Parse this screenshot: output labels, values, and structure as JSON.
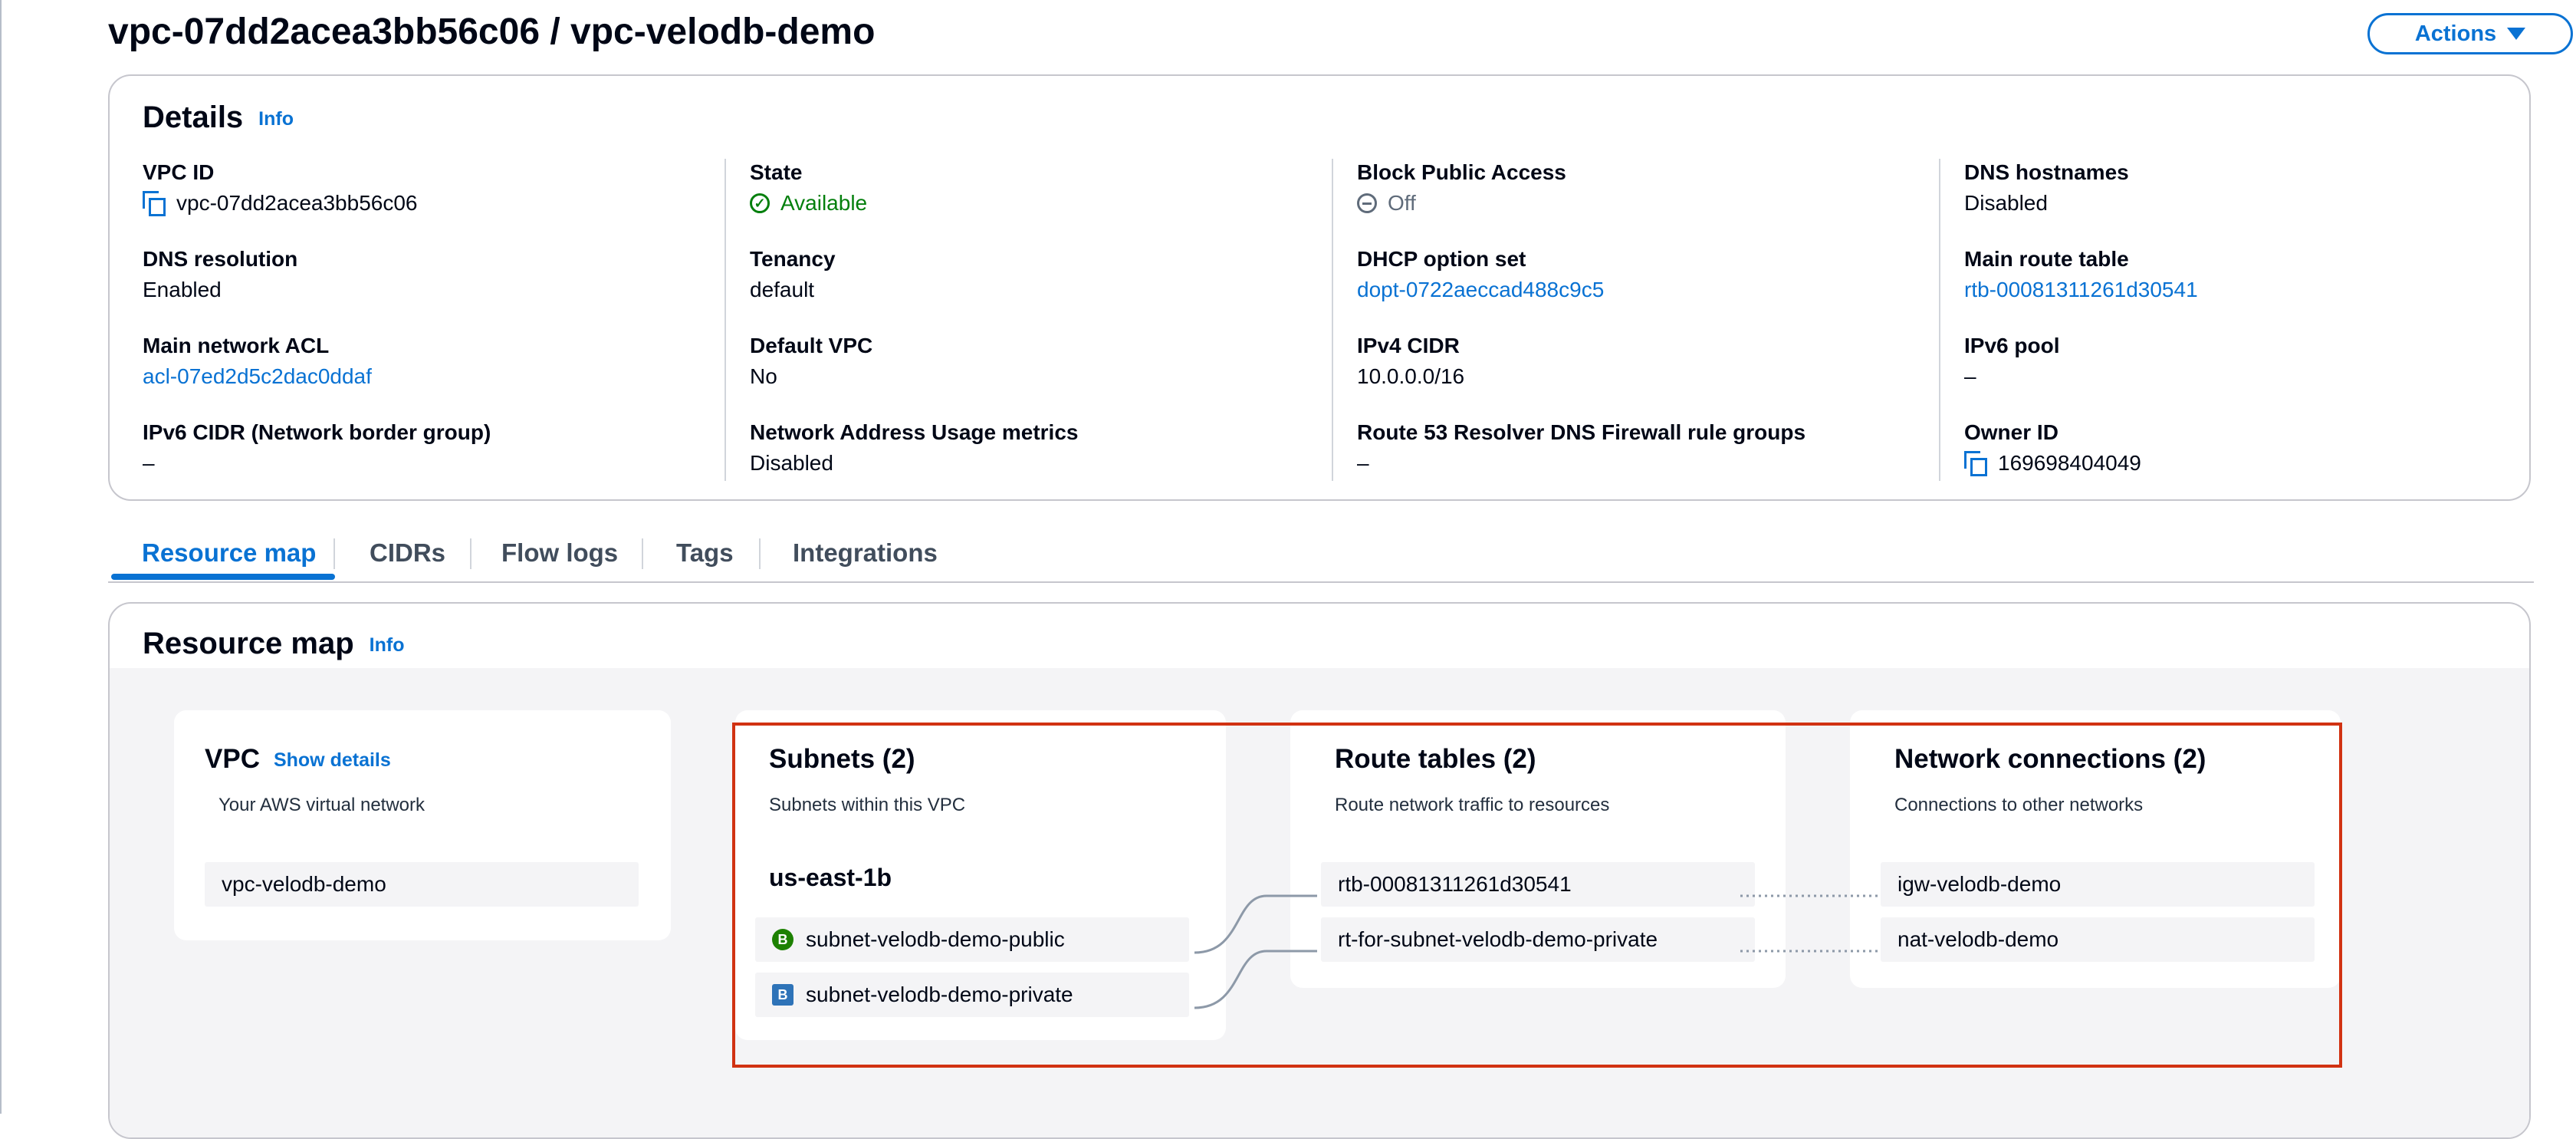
{
  "page": {
    "title": "vpc-07dd2acea3bb56c06 / vpc-velodb-demo",
    "actions_label": "Actions"
  },
  "details": {
    "title": "Details",
    "info": "Info",
    "fields": {
      "vpc_id": {
        "label": "VPC ID",
        "value": "vpc-07dd2acea3bb56c06"
      },
      "state": {
        "label": "State",
        "value": "Available"
      },
      "block_public_access": {
        "label": "Block Public Access",
        "value": "Off"
      },
      "dns_hostnames": {
        "label": "DNS hostnames",
        "value": "Disabled"
      },
      "dns_resolution": {
        "label": "DNS resolution",
        "value": "Enabled"
      },
      "tenancy": {
        "label": "Tenancy",
        "value": "default"
      },
      "dhcp_option_set": {
        "label": "DHCP option set",
        "value": "dopt-0722aeccad488c9c5"
      },
      "main_route_table": {
        "label": "Main route table",
        "value": "rtb-00081311261d30541"
      },
      "main_network_acl": {
        "label": "Main network ACL",
        "value": "acl-07ed2d5c2dac0ddaf"
      },
      "default_vpc": {
        "label": "Default VPC",
        "value": "No"
      },
      "ipv4_cidr": {
        "label": "IPv4 CIDR",
        "value": "10.0.0.0/16"
      },
      "ipv6_pool": {
        "label": "IPv6 pool",
        "value": "–"
      },
      "ipv6_cidr": {
        "label": "IPv6 CIDR (Network border group)",
        "value": "–"
      },
      "nau_metrics": {
        "label": "Network Address Usage metrics",
        "value": "Disabled"
      },
      "route53_firewall": {
        "label": "Route 53 Resolver DNS Firewall rule groups",
        "value": "–"
      },
      "owner_id": {
        "label": "Owner ID",
        "value": "169698404049"
      }
    }
  },
  "tabs": [
    {
      "label": "Resource map",
      "active": true
    },
    {
      "label": "CIDRs",
      "active": false
    },
    {
      "label": "Flow logs",
      "active": false
    },
    {
      "label": "Tags",
      "active": false
    },
    {
      "label": "Integrations",
      "active": false
    }
  ],
  "resource_map": {
    "title": "Resource map",
    "info": "Info",
    "vpc": {
      "title": "VPC",
      "show_details": "Show details",
      "subtitle": "Your AWS virtual network",
      "item": "vpc-velodb-demo"
    },
    "subnets": {
      "title": "Subnets (2)",
      "subtitle": "Subnets within this VPC",
      "az": "us-east-1b",
      "items": [
        {
          "name": "subnet-velodb-demo-public",
          "badge": "B",
          "type": "public"
        },
        {
          "name": "subnet-velodb-demo-private",
          "badge": "B",
          "type": "private"
        }
      ]
    },
    "route_tables": {
      "title": "Route tables (2)",
      "subtitle": "Route network traffic to resources",
      "items": [
        "rtb-00081311261d30541",
        "rt-for-subnet-velodb-demo-private"
      ]
    },
    "network_connections": {
      "title": "Network connections (2)",
      "subtitle": "Connections to other networks",
      "items": [
        "igw-velodb-demo",
        "nat-velodb-demo"
      ]
    }
  },
  "colors": {
    "link": "#0972d3",
    "success": "#037f0c",
    "highlight": "#d13212",
    "public_badge": "#1d8102",
    "private_badge": "#2e73b8"
  }
}
